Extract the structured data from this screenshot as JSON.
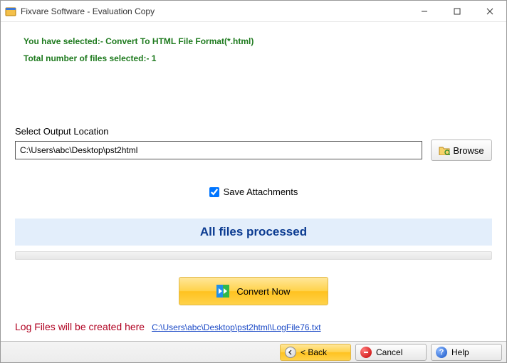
{
  "window": {
    "title": "Fixvare Software - Evaluation Copy"
  },
  "info": {
    "selection_line": "You have selected:- Convert To HTML File Format(*.html)",
    "count_line": "Total number of files selected:- 1"
  },
  "output": {
    "label": "Select Output Location",
    "path": "C:\\Users\\abc\\Desktop\\pst2html",
    "browse_label": "Browse"
  },
  "save_attachments": {
    "label": "Save Attachments",
    "checked": true
  },
  "status": {
    "text": "All files processed"
  },
  "convert": {
    "label": "Convert Now"
  },
  "log": {
    "label": "Log Files will be created here",
    "link": "C:\\Users\\abc\\Desktop\\pst2html\\LogFile76.txt"
  },
  "footer": {
    "back": "< Back",
    "cancel": "Cancel",
    "help": "Help"
  }
}
